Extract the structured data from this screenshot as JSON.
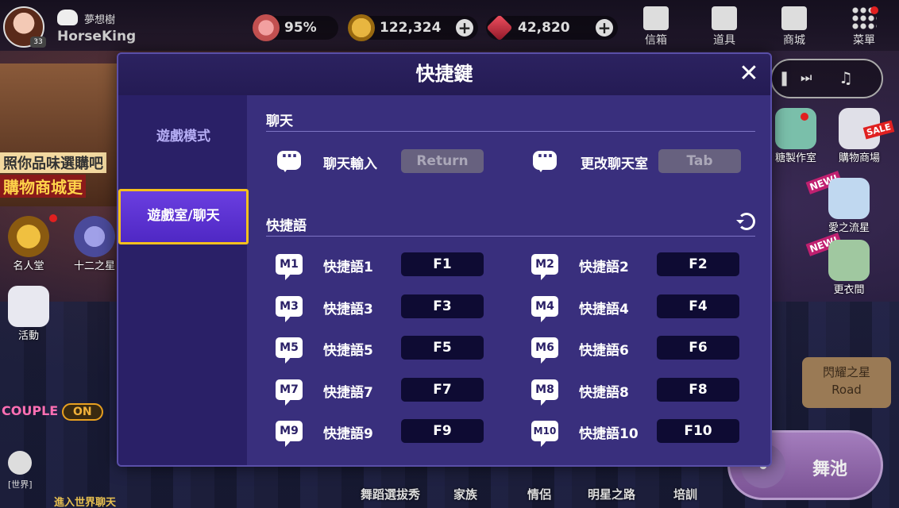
{
  "topbar": {
    "level": "33",
    "guild_name": "夢想樹",
    "player_name": "HorseKing",
    "heart_value": "95%",
    "gold_value": "122,324",
    "gem_value": "42,820",
    "menu": [
      {
        "label": "信箱"
      },
      {
        "label": "道具"
      },
      {
        "label": "商城"
      },
      {
        "label": "菜單"
      }
    ]
  },
  "background": {
    "banner_line1": "照你品味選購吧",
    "banner_line2": "購物商城更",
    "hall_of_fame": "名人堂",
    "twelve_stars": "十二之星",
    "activity": "活動",
    "couple": "COUPLE",
    "couple_state": "ON",
    "world_label": "[世界]",
    "world_chat": "進入世界聊天",
    "candy_studio": "糖製作室",
    "shopping_mall": "購物商場",
    "sale": "SALE",
    "love_meteor": "愛之流星",
    "new_badge": "NEW!",
    "wardrobe": "更衣間",
    "road_title": "閃耀之星",
    "road_sub": "Road",
    "dance_pool": "舞池",
    "bottom_nav": [
      "舞蹈選拔秀",
      "家族",
      "情侶",
      "明星之路",
      "培訓"
    ]
  },
  "dialog": {
    "title": "快捷鍵",
    "tabs": [
      {
        "label": "遊戲模式",
        "active": false
      },
      {
        "label": "遊戲室/聊天",
        "active": true
      }
    ],
    "chat_section": {
      "heading": "聊天",
      "items": [
        {
          "label": "聊天輸入",
          "key": "Return",
          "icon": "chat-input-icon"
        },
        {
          "label": "更改聊天室",
          "key": "Tab",
          "icon": "chat-room-change-icon"
        }
      ]
    },
    "quick_section": {
      "heading": "快捷語",
      "items": [
        {
          "badge": "M1",
          "label": "快捷語1",
          "key": "F1"
        },
        {
          "badge": "M2",
          "label": "快捷語2",
          "key": "F2"
        },
        {
          "badge": "M3",
          "label": "快捷語3",
          "key": "F3"
        },
        {
          "badge": "M4",
          "label": "快捷語4",
          "key": "F4"
        },
        {
          "badge": "M5",
          "label": "快捷語5",
          "key": "F5"
        },
        {
          "badge": "M6",
          "label": "快捷語6",
          "key": "F6"
        },
        {
          "badge": "M7",
          "label": "快捷語7",
          "key": "F7"
        },
        {
          "badge": "M8",
          "label": "快捷語8",
          "key": "F8"
        },
        {
          "badge": "M9",
          "label": "快捷語9",
          "key": "F9"
        },
        {
          "badge": "M10",
          "label": "快捷語10",
          "key": "F10"
        }
      ]
    }
  },
  "colors": {
    "dialog_bg": "#392f7d",
    "sidebar_bg": "#2a2067",
    "active_tab": "#5a32d2",
    "active_border": "#f5c01e",
    "key_bg": "#0e0b33",
    "key_disabled_bg": "#67617f"
  }
}
